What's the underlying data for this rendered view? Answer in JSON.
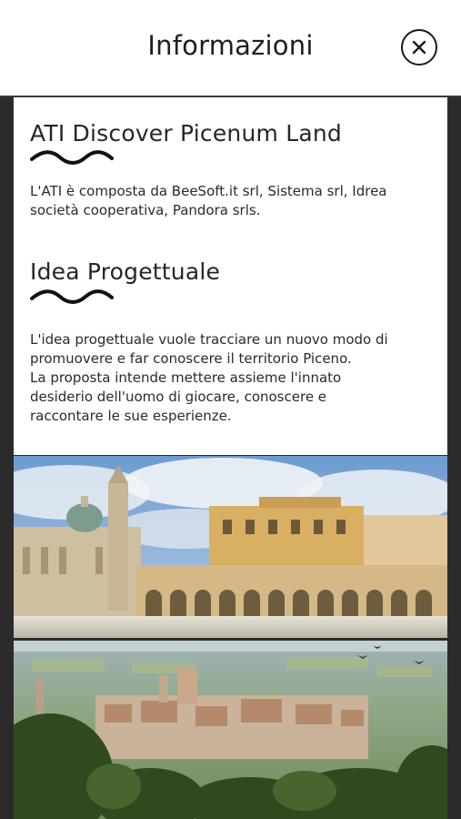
{
  "header": {
    "title": "Informazioni",
    "close_icon": "close-icon"
  },
  "sections": [
    {
      "title": "ATI Discover Picenum Land",
      "text": "L'ATI è composta da BeeSoft.it srl, Sistema srl, Idrea società cooperativa, Pandora srls."
    },
    {
      "title": "Idea Progettuale",
      "text_lines": [
        "L'idea progettuale vuole tracciare un nuovo modo di",
        "promuovere e far conoscere il territorio Piceno.",
        "La proposta intende mettere assieme l'innato",
        "desiderio dell'uomo di giocare, conoscere e",
        "raccontare le sue esperienze."
      ]
    }
  ],
  "images": [
    {
      "subject": "piazza-with-church-and-arcades"
    },
    {
      "subject": "hilltop-town-panorama"
    }
  ],
  "colors": {
    "frame": "#2b2b2b",
    "text": "#262626",
    "sky": "#7fa9d6"
  }
}
